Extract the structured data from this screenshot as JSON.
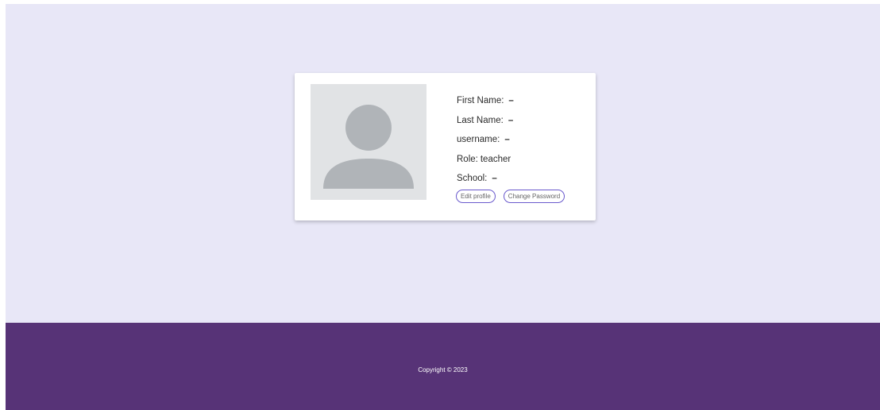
{
  "profile": {
    "fields": [
      {
        "label": "First Name:",
        "value": "–"
      },
      {
        "label": "Last Name:",
        "value": "–"
      },
      {
        "label": "username:",
        "value": "–"
      },
      {
        "label": "Role:",
        "value": "teacher"
      },
      {
        "label": "School:",
        "value": "–"
      }
    ],
    "avatar_icon": "user-placeholder-icon"
  },
  "actions": {
    "edit_label": "Edit profile",
    "change_password_label": "Change Password"
  },
  "footer": {
    "copyright": "Copyright © 2023"
  },
  "colors": {
    "background": "#e8e7f7",
    "card": "#ffffff",
    "footer": "#573377",
    "button_border": "#6a5acd",
    "avatar_bg": "#e1e3e5",
    "avatar_fg": "#b0b4b8"
  }
}
